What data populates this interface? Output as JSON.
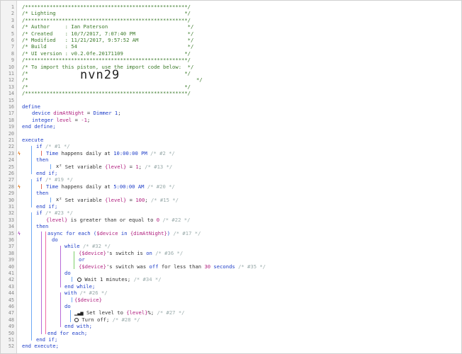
{
  "header": {
    "border_top": "/*****************************************************/",
    "title": "/* Lighting                                          */",
    "border_2": "/*****************************************************/",
    "author": "/* Author     : Ian Paterson                          */",
    "created": "/* Created    : 10/7/2017, 7:07:40 PM                 */",
    "modified": "/* Modified   : 11/21/2017, 9:57:52 AM                */",
    "build": "/* Build      : 54                                    */",
    "ui_version": "/* UI version : v0.2.0fe.20171109                    */",
    "border_3": "/*****************************************************/",
    "import_note": "/* To import this piston, use the import code below:  */",
    "blank_1": "/*                                                   */",
    "blank_2_left": "/*",
    "import_code": "nvn29",
    "blank_2_right": "*/",
    "blank_3": "/*                                                   */",
    "border_bottom": "/*****************************************************/"
  },
  "code": {
    "define": "define",
    "device_kw": "device",
    "device_name": "dimAtNight",
    "eq": " = ",
    "device_value": "Dimmer 1",
    "semi": ";",
    "integer_kw": "integer",
    "var_name": "level",
    "var_value": "-1",
    "end_define": "end define;",
    "execute": "execute",
    "if": "if",
    "c1": "/* #1 */",
    "time_kw": "Time",
    "happens_daily_at": " happens daily at ",
    "time1": "10:00:00 PM",
    "c2": "/* #2 */",
    "then": "then",
    "set_variable": " Set variable ",
    "level_var": "{level}",
    "eq1": " = ",
    "val1": "1",
    "c13": "/* #13 */",
    "end_if": "end if;",
    "c19": "/* #19 */",
    "time2": "5:00:00 AM",
    "c20": "/* #20 */",
    "val100": "100",
    "c15": "/* #15 */",
    "c23": "/* #23 */",
    "level_paren": "{level}",
    "is_gte": " is greater than or equal to ",
    "zero": "0",
    "c22": "/* #22 */",
    "async": "async",
    "for_each": " for each (",
    "device_var": "$device",
    "in": " in ",
    "dim_var": "{dimAtNight}",
    "close_paren": ")",
    "c17": "/* #17 */",
    "do": "do",
    "while": "while",
    "c32": "/* #32 */",
    "switch_is": "'s switch is ",
    "on": "on",
    "c36": "/* #36 */",
    "or": "or",
    "switch_was": "'s switch was ",
    "off": "off",
    "for_less_than": " for less than ",
    "thirty": "30",
    "seconds": " seconds",
    "c35": "/* #35 */",
    "wait": " Wait 1 minutes;",
    "c34": "/* #34 */",
    "end_while": "end while;",
    "with": "with",
    "c26": "/* #26 */",
    "device_paren": "{$device}",
    "set_level": " Set level to ",
    "pct": "%;",
    "c27": "/* #27 */",
    "turn_off": " Turn off;",
    "c28": "/* #28 */",
    "end_with": "end with;",
    "end_for_each": "end for each;",
    "end_execute": "end execute;"
  },
  "line_numbers": [
    "1",
    "2",
    "3",
    "4",
    "5",
    "6",
    "7",
    "8",
    "9",
    "10",
    "11",
    "12",
    "13",
    "14",
    "15",
    "16",
    "17",
    "18",
    "19",
    "20",
    "21",
    "22",
    "23",
    "24",
    "25",
    "26",
    "27",
    "28",
    "29",
    "30",
    "31",
    "32",
    "33",
    "34",
    "35",
    "36",
    "37",
    "38",
    "39",
    "40",
    "41",
    "42",
    "43",
    "44",
    "45",
    "46",
    "47",
    "48",
    "49",
    "50",
    "51",
    "52"
  ],
  "colors": {
    "comment": "#3b7a2a",
    "keyword": "#1e3ec8",
    "variable": "#b0207f",
    "gutter": "#f3f3f3"
  }
}
